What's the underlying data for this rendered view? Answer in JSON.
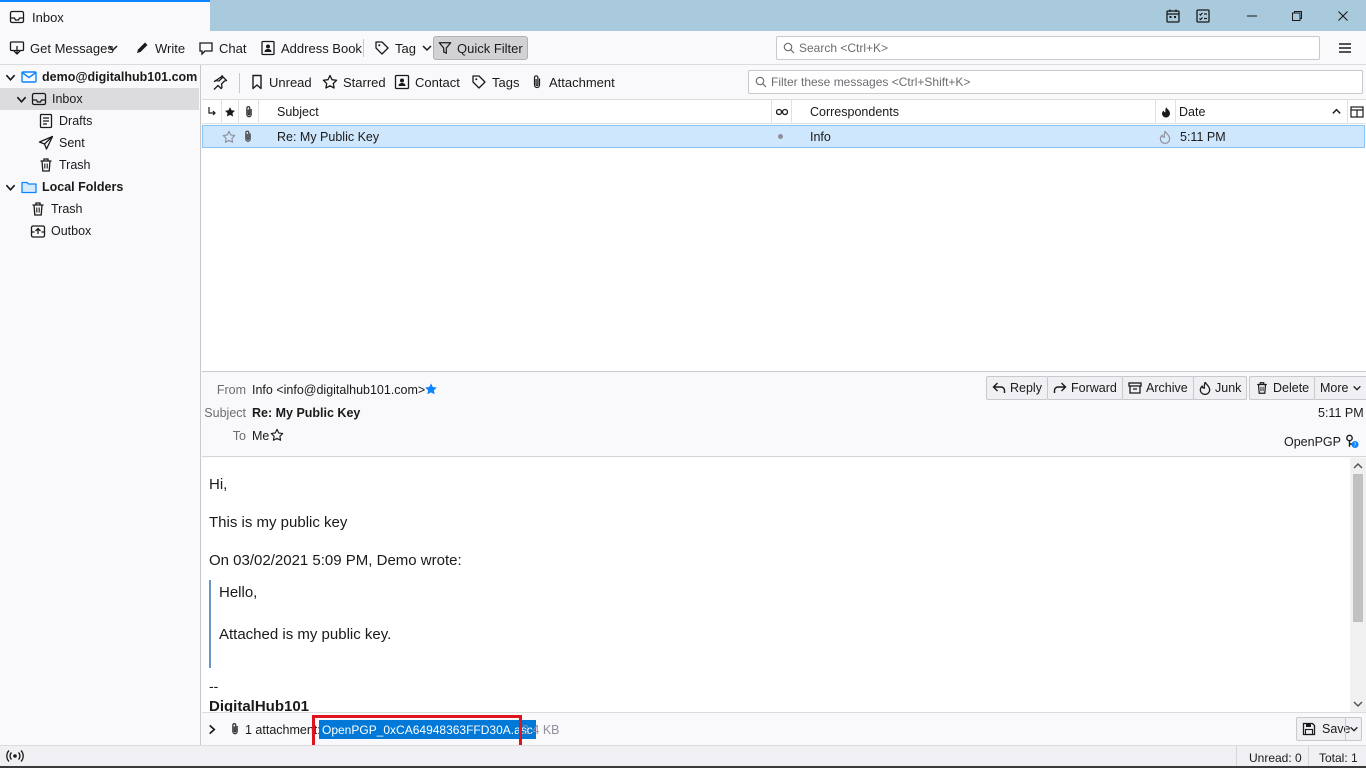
{
  "window": {
    "tab_title": "Inbox",
    "colors": {
      "titlebar": "#a9c9dc",
      "accent": "#0a84ff",
      "selection": "#0078d7",
      "highlight_box": "#e0141e"
    }
  },
  "toolbar": {
    "get_messages": "Get Messages",
    "write": "Write",
    "chat": "Chat",
    "address_book": "Address Book",
    "tag": "Tag",
    "quick_filter": "Quick Filter",
    "search_placeholder": "Search <Ctrl+K>"
  },
  "folders": {
    "account": "demo@digitalhub101.com",
    "inbox": "Inbox",
    "drafts": "Drafts",
    "sent": "Sent",
    "trash": "Trash",
    "local_folders": "Local Folders",
    "local_trash": "Trash",
    "outbox": "Outbox"
  },
  "quick_filter": {
    "unread": "Unread",
    "starred": "Starred",
    "contact": "Contact",
    "tags": "Tags",
    "attachment": "Attachment",
    "filter_placeholder": "Filter these messages <Ctrl+Shift+K>"
  },
  "thread": {
    "columns": {
      "subject": "Subject",
      "correspondents": "Correspondents",
      "date": "Date"
    },
    "rows": [
      {
        "subject": "Re: My Public Key",
        "correspondent": "Info",
        "date": "5:11 PM"
      }
    ]
  },
  "header": {
    "from_label": "From",
    "from_value": "Info <info@digitalhub101.com>",
    "subject_label": "Subject",
    "subject_value": "Re: My Public Key",
    "to_label": "To",
    "to_value": "Me",
    "time": "5:11 PM",
    "openpgp": "OpenPGP",
    "buttons": {
      "reply": "Reply",
      "forward": "Forward",
      "archive": "Archive",
      "junk": "Junk",
      "delete": "Delete",
      "more": "More"
    }
  },
  "body": {
    "greeting": "Hi,",
    "line1": "This is my public key",
    "quote_header": "On 03/02/2021 5:09 PM, Demo wrote:",
    "quote_line1": "Hello,",
    "quote_line2": "Attached is my public key.",
    "sig_sep": "--",
    "sig_name": "DigitalHub101"
  },
  "attachments": {
    "count_label": "1 attachment:",
    "file_name": "OpenPGP_0xCA64948363FFD30A.asc",
    "file_size": "2.4 KB",
    "save": "Save"
  },
  "status": {
    "unread": "Unread: 0",
    "total": "Total: 1"
  }
}
